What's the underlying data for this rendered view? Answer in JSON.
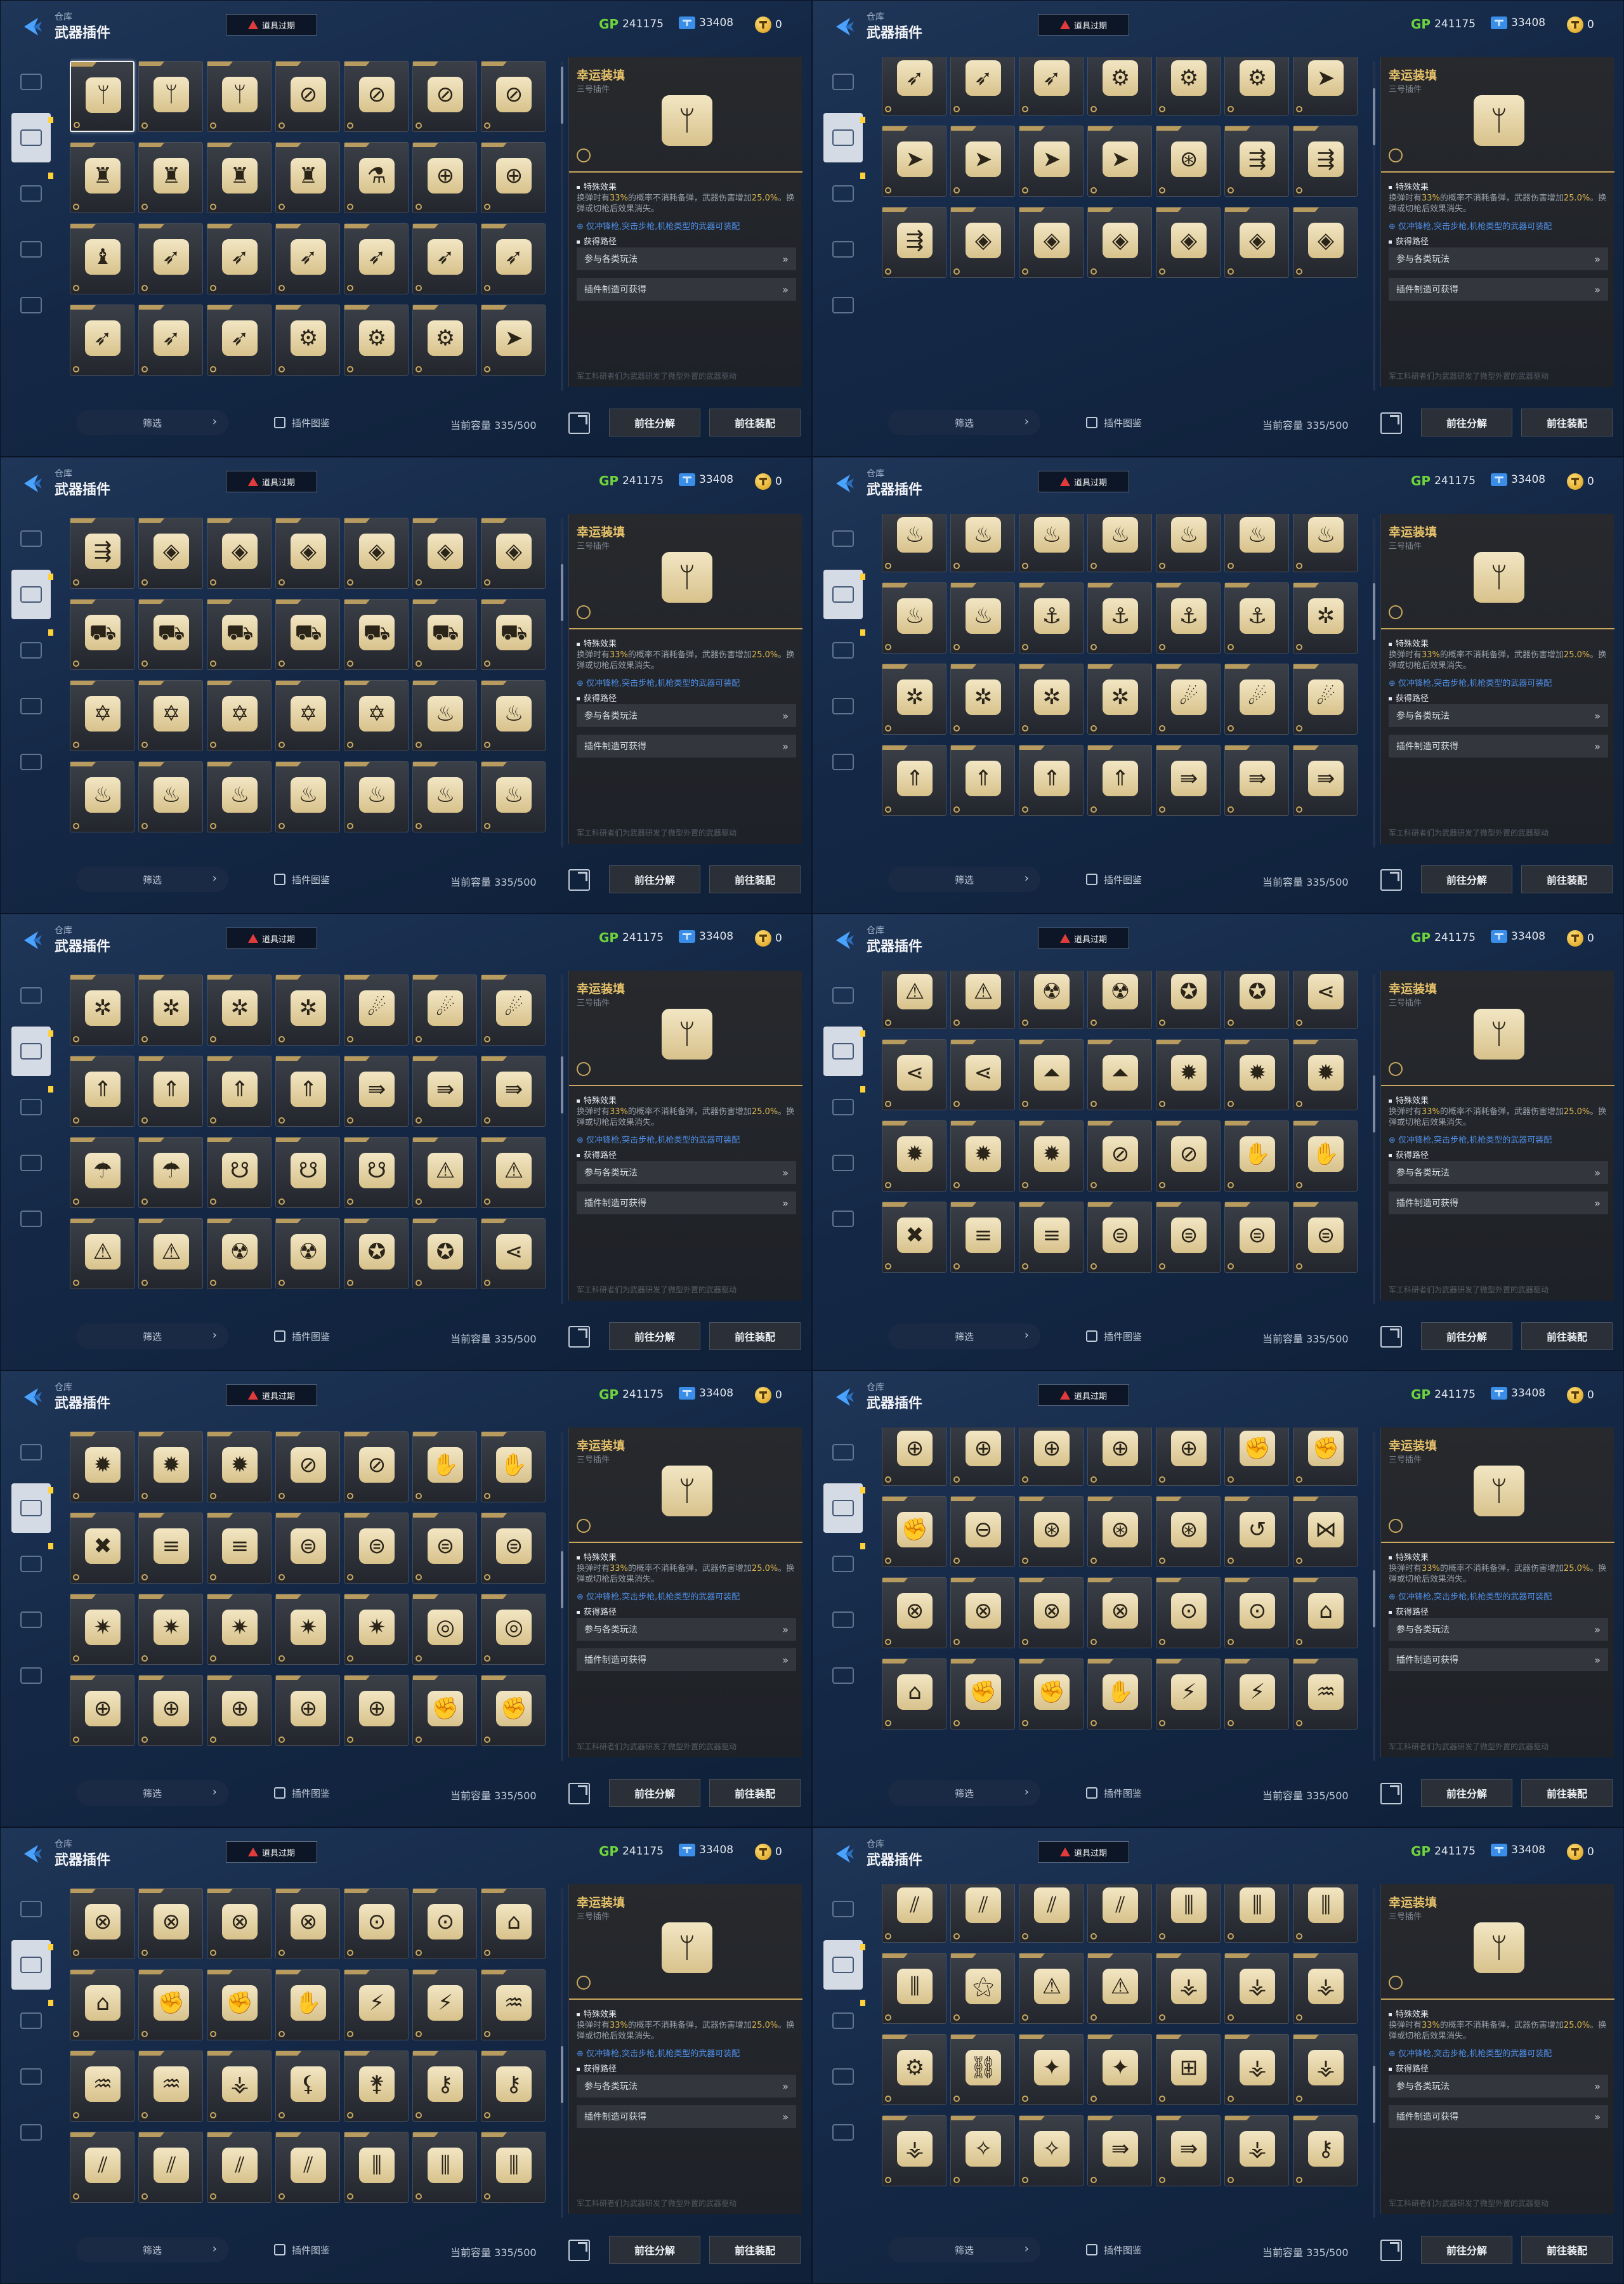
{
  "header": {
    "crumb": "仓库",
    "title": "武器插件",
    "expired_label": "道具过期",
    "gp_label": "GP",
    "gp_value": "241175",
    "ticket_value": "33408",
    "coin_value": "0"
  },
  "sidebar": {
    "items": [
      {
        "name": "weapon"
      },
      {
        "name": "plugin"
      },
      {
        "name": "grenade"
      },
      {
        "name": "vehicle"
      },
      {
        "name": "insignia"
      }
    ]
  },
  "detail": {
    "name": "幸运装填",
    "subtitle": "三号插件",
    "special_title": "特殊效果",
    "desc_prefix": "换弹时有",
    "desc_highlight1": "33%",
    "desc_mid": "的概率不消耗备弹，武器伤害增加",
    "desc_highlight2": "25.0%",
    "desc_suffix": "。换弹或切枪后效果消失。",
    "note": "仅冲锋枪,突击步枪,机枪类型的武器可装配",
    "source_title": "获得路径",
    "route1": "参与各类玩法",
    "route2": "插件制造可获得",
    "footer": "军工科研者们为武器研发了微型外置的武器驱动"
  },
  "bottom": {
    "filter_label": "筛选",
    "atlas_label": "插件图鉴",
    "capacity_label": "当前容量 335/500",
    "dismantle_label": "前往分解",
    "equip_label": "前往装配"
  },
  "panels": [
    {
      "scroll": 0.02,
      "rows": [
        [
          "ᛘ",
          "ᛘ",
          "ᛘ",
          "⊘",
          "⊘",
          "⊘",
          "⊘"
        ],
        [
          "♜",
          "♜",
          "♜",
          "♜",
          "⚗",
          "⊕",
          "⊕"
        ],
        [
          "♝",
          "➶",
          "➶",
          "➶",
          "➶",
          "➶",
          "➶"
        ],
        [
          "➶",
          "➶",
          "➶",
          "⚙",
          "⚙",
          "⚙",
          "➤"
        ]
      ]
    },
    {
      "scroll": 0.1,
      "rows": [
        [
          "➶",
          "➶",
          "➶",
          "⚙",
          "⚙",
          "⚙",
          "➤"
        ],
        [
          "➤",
          "➤",
          "➤",
          "➤",
          "⊛",
          "⇶",
          "⇶"
        ],
        [
          "⇶",
          "◈",
          "◈",
          "◈",
          "◈",
          "◈",
          "◈"
        ]
      ]
    },
    {
      "scroll": 0.17,
      "rows": [
        [
          "⇶",
          "◈",
          "◈",
          "◈",
          "◈",
          "◈",
          "◈"
        ],
        [
          "⛟",
          "⛟",
          "⛟",
          "⛟",
          "⛟",
          "⛟",
          "⛟"
        ],
        [
          "✡",
          "✡",
          "✡",
          "✡",
          "✡",
          "♨",
          "♨"
        ],
        [
          "♨",
          "♨",
          "♨",
          "♨",
          "♨",
          "♨",
          "♨"
        ]
      ]
    },
    {
      "scroll": 0.24,
      "rows": [
        [
          "♨",
          "♨",
          "♨",
          "♨",
          "♨",
          "♨",
          "♨"
        ],
        [
          "♨",
          "♨",
          "⚓",
          "⚓",
          "⚓",
          "⚓",
          "✲"
        ],
        [
          "✲",
          "✲",
          "✲",
          "✲",
          "☄",
          "☄",
          "☄"
        ],
        [
          "⇑",
          "⇑",
          "⇑",
          "⇑",
          "⇛",
          "⇛",
          "⇛"
        ]
      ]
    },
    {
      "scroll": 0.3,
      "rows": [
        [
          "✲",
          "✲",
          "✲",
          "✲",
          "☄",
          "☄",
          "☄"
        ],
        [
          "⇑",
          "⇑",
          "⇑",
          "⇑",
          "⇛",
          "⇛",
          "⇛"
        ],
        [
          "☂",
          "☂",
          "☋",
          "☋",
          "☋",
          "⚠",
          "⚠"
        ],
        [
          "⚠",
          "⚠",
          "☢",
          "☢",
          "✪",
          "✪",
          "⋖"
        ]
      ]
    },
    {
      "scroll": 0.37,
      "rows": [
        [
          "⚠",
          "⚠",
          "☢",
          "☢",
          "✪",
          "✪",
          "⋖"
        ],
        [
          "⋖",
          "⋖",
          "⏶",
          "⏶",
          "✹",
          "✹",
          "✹"
        ],
        [
          "✹",
          "✹",
          "✹",
          "⊘",
          "⊘",
          "✋",
          "✋"
        ],
        [
          "✖",
          "≡",
          "≡",
          "⊜",
          "⊜",
          "⊜",
          "⊜"
        ]
      ]
    },
    {
      "scroll": 0.44,
      "rows": [
        [
          "✹",
          "✹",
          "✹",
          "⊘",
          "⊘",
          "✋",
          "✋"
        ],
        [
          "✖",
          "≡",
          "≡",
          "⊜",
          "⊜",
          "⊜",
          "⊜"
        ],
        [
          "✷",
          "✷",
          "✷",
          "✷",
          "✷",
          "◎",
          "◎"
        ],
        [
          "⊕",
          "⊕",
          "⊕",
          "⊕",
          "⊕",
          "✊",
          "✊"
        ]
      ]
    },
    {
      "scroll": 0.51,
      "rows": [
        [
          "⊕",
          "⊕",
          "⊕",
          "⊕",
          "⊕",
          "✊",
          "✊"
        ],
        [
          "✊",
          "⊖",
          "⊛",
          "⊛",
          "⊛",
          "↺",
          "⋈"
        ],
        [
          "⊗",
          "⊗",
          "⊗",
          "⊗",
          "⊙",
          "⊙",
          "⌂"
        ],
        [
          "⌂",
          "✊",
          "✊",
          "✋",
          "⚡",
          "⚡",
          "♒"
        ]
      ]
    },
    {
      "scroll": 0.58,
      "rows": [
        [
          "⊗",
          "⊗",
          "⊗",
          "⊗",
          "⊙",
          "⊙",
          "⌂"
        ],
        [
          "⌂",
          "✊",
          "✊",
          "✋",
          "⚡",
          "⚡",
          "♒"
        ],
        [
          "♒",
          "♒",
          "⚶",
          "⚸",
          "⚵",
          "⚷",
          "⚷"
        ],
        [
          "⫽",
          "⫽",
          "⫽",
          "⫽",
          "⫼",
          "⫼",
          "⫼"
        ]
      ]
    },
    {
      "scroll": 0.65,
      "rows": [
        [
          "⫽",
          "⫽",
          "⫽",
          "⫽",
          "⫼",
          "⫼",
          "⫼"
        ],
        [
          "⫼",
          "⚝",
          "⚠",
          "⚠",
          "⚶",
          "⚶",
          "⚶"
        ],
        [
          "⚙",
          "⛓",
          "✦",
          "✦",
          "⊞",
          "⚶",
          "⚶"
        ],
        [
          "⚶",
          "✧",
          "✧",
          "⇛",
          "⇛",
          "⚶",
          "⚷"
        ]
      ]
    }
  ]
}
